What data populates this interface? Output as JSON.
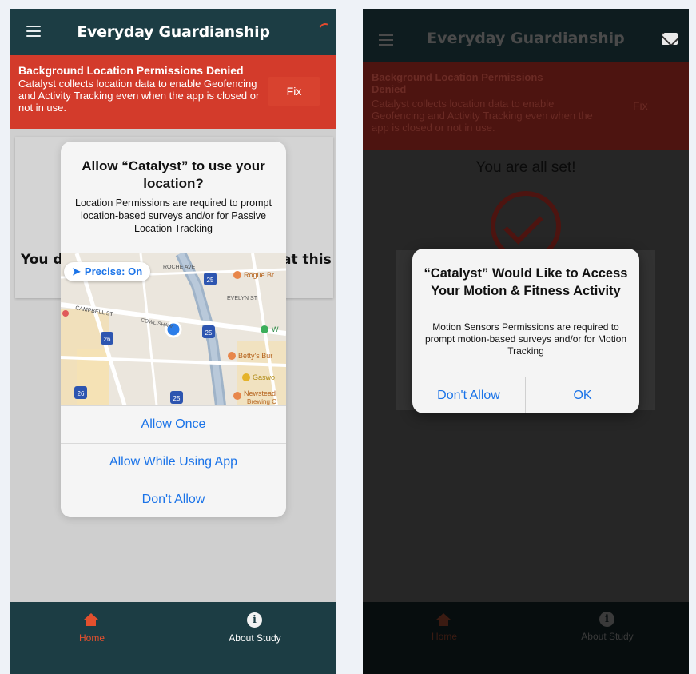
{
  "app": {
    "title": "Everyday Guardianship"
  },
  "banner": {
    "title": "Background Location Permissions Denied",
    "text": "Catalyst collects location data to enable Geofencing and Activity Tracking even when the app is closed or not in use.",
    "fix_label": "Fix"
  },
  "left_screen": {
    "background_text_left": "You do",
    "background_text_right": "at this"
  },
  "location_dialog": {
    "title": "Allow “Catalyst” to use your location?",
    "message": "Location Permissions are required to prompt location-based surveys and/or for Passive Location Tracking",
    "precise_label": "Precise: On",
    "map_labels": {
      "roche_ave": "ROCHE AVE",
      "evelyn_st": "EVELYN ST",
      "campbell_st": "CAMPBELL ST",
      "cowlishaw": "COWLISHAW",
      "rogue": "Rogue Br",
      "w": "W",
      "bettys": "Betty's Bur",
      "gasworks": "Gaswo",
      "newstead": "Newstead",
      "brewing": "Brewing C",
      "shield_25": "25",
      "shield_26": "26"
    },
    "buttons": {
      "allow_once": "Allow Once",
      "allow_while": "Allow While Using App",
      "dont_allow": "Don't Allow"
    }
  },
  "tabs": {
    "home": "Home",
    "about": "About Study"
  },
  "right_screen": {
    "banner_title": "Background Location Permissions Denied",
    "banner_text": "Catalyst collects location data to enable Geofencing and Activity Tracking even when the app is closed or not in use.",
    "all_set": "You are all set!",
    "motion_dialog": {
      "title": "“Catalyst” Would Like to Access Your Motion & Fitness Activity",
      "message": "Motion Sensors Permissions are required to prompt motion-based surveys and/or for Motion Tracking",
      "dont_allow": "Don't Allow",
      "ok": "OK"
    }
  },
  "colors": {
    "header": "#1c3d44",
    "banner": "#d33b2b",
    "accent": "#e3502e",
    "ios_blue": "#1a73e8"
  }
}
